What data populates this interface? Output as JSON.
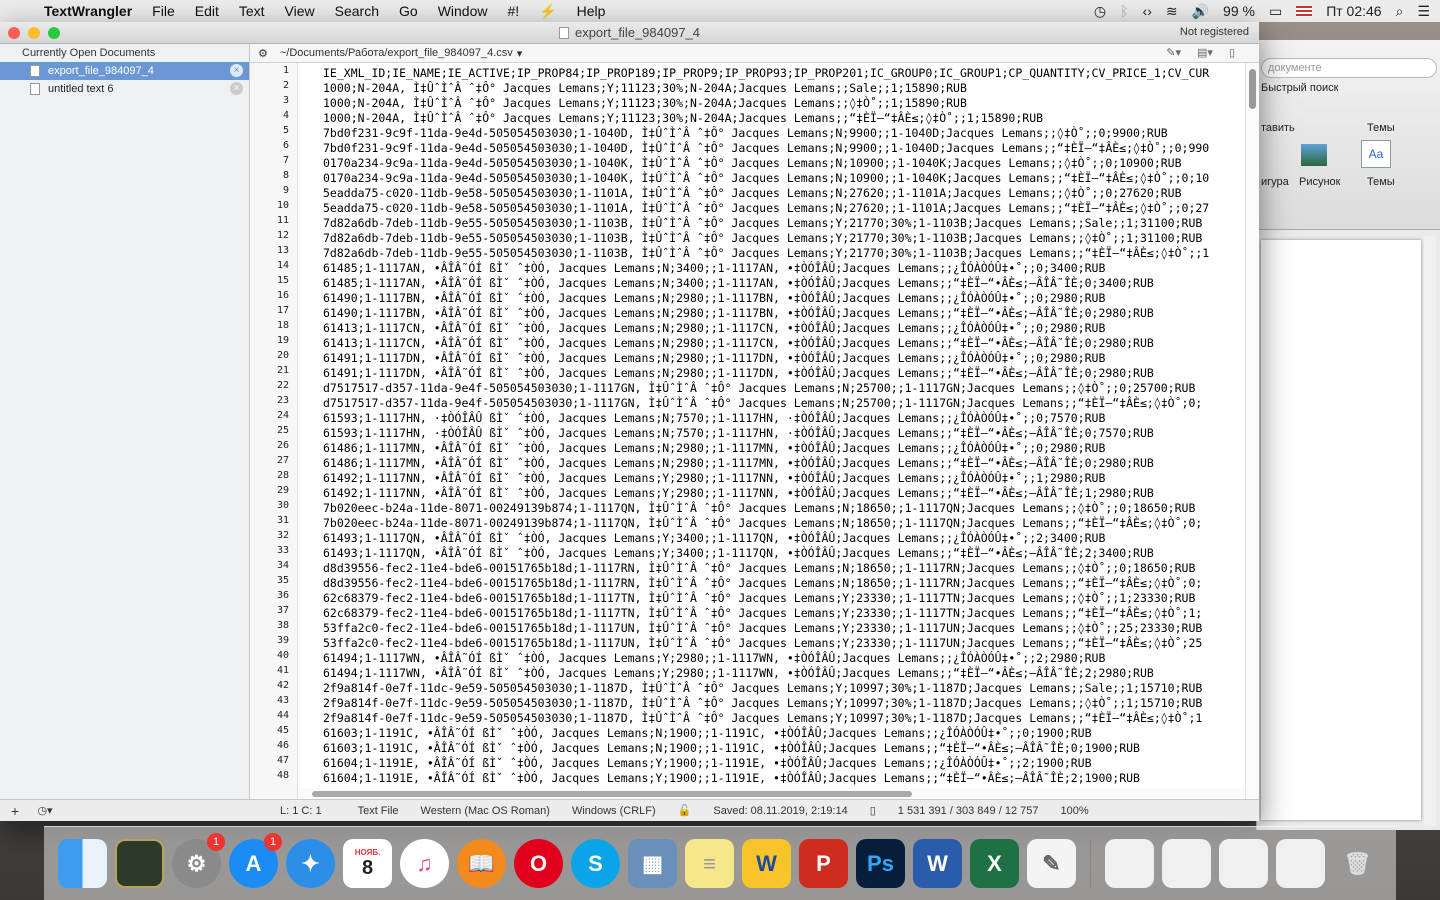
{
  "menubar": {
    "app": "TextWrangler",
    "items": [
      "File",
      "Edit",
      "Text",
      "View",
      "Search",
      "Go",
      "Window",
      "#!",
      "Help"
    ],
    "battery": "99 %",
    "clock": "Пт 02:46"
  },
  "window": {
    "title": "export_file_984097_4",
    "not_registered": "Not registered"
  },
  "sidebar": {
    "header": "Currently Open Documents",
    "docs": [
      "export_file_984097_4",
      "untitled text 6"
    ]
  },
  "navbar": {
    "path": "~/Documents/Работа/export_file_984097_4.csv"
  },
  "editor": {
    "line_numbers": [
      "1",
      "2",
      "3",
      "4",
      "5",
      "6",
      "7",
      "8",
      "9",
      "10",
      "11",
      "12",
      "13",
      "14",
      "15",
      "16",
      "17",
      "18",
      "19",
      "20",
      "21",
      "22",
      "23",
      "24",
      "25",
      "26",
      "27",
      "28",
      "29",
      "30",
      "31",
      "32",
      "33",
      "34",
      "35",
      "36",
      "37",
      "38",
      "39",
      "40",
      "41",
      "42",
      "43",
      "44",
      "45",
      "46",
      "47",
      "48"
    ],
    "lines": [
      "IE_XML_ID;IE_NAME;IE_ACTIVE;IP_PROP84;IP_PROP189;IP_PROP9;IP_PROP93;IP_PROP201;IC_GROUP0;IC_GROUP1;CP_QUANTITY;CV_PRICE_1;CV_CUR",
      "1000;N-204A, Ì‡ÛˆÌˆÂ ˆ‡Ô° Jacques Lemans;Y;11123;30%;N-204A;Jacques Lemans;;Sale;;1;15890;RUB",
      "1000;N-204A, Ì‡ÛˆÌˆÂ ˆ‡Ô° Jacques Lemans;Y;11123;30%;N-204A;Jacques Lemans;;◊‡Ò˚;;1;15890;RUB",
      "1000;N-204A, Ì‡ÛˆÌˆÂ ˆ‡Ô° Jacques Lemans;Y;11123;30%;N-204A;Jacques Lemans;;“‡ÈÏ–“‡ÂÈ≤;◊‡Ò˚;;1;15890;RUB",
      "7bd0f231-9c9f-11da-9e4d-505054503030;1-1040D, Ì‡ÛˆÌˆÂ ˆ‡Ô° Jacques Lemans;N;9900;;1-1040D;Jacques Lemans;;◊‡Ò˚;;0;9900;RUB",
      "7bd0f231-9c9f-11da-9e4d-505054503030;1-1040D, Ì‡ÛˆÌˆÂ ˆ‡Ô° Jacques Lemans;N;9900;;1-1040D;Jacques Lemans;;“‡ÈÏ–“‡ÂÈ≤;◊‡Ò˚;;0;990",
      "0170a234-9c9a-11da-9e4d-505054503030;1-1040K, Ì‡ÛˆÌˆÂ ˆ‡Ô° Jacques Lemans;N;10900;;1-1040K;Jacques Lemans;;◊‡Ò˚;;0;10900;RUB",
      "0170a234-9c9a-11da-9e4d-505054503030;1-1040K, Ì‡ÛˆÌˆÂ ˆ‡Ô° Jacques Lemans;N;10900;;1-1040K;Jacques Lemans;;“‡ÈÏ–“‡ÂÈ≤;◊‡Ò˚;;0;10",
      "5eadda75-c020-11db-9e58-505054503030;1-1101A, Ì‡ÛˆÌˆÂ ˆ‡Ô° Jacques Lemans;N;27620;;1-1101A;Jacques Lemans;;◊‡Ò˚;;0;27620;RUB",
      "5eadda75-c020-11db-9e58-505054503030;1-1101A, Ì‡ÛˆÌˆÂ ˆ‡Ô° Jacques Lemans;N;27620;;1-1101A;Jacques Lemans;;“‡ÈÏ–“‡ÂÈ≤;◊‡Ò˚;;0;27",
      "7d82a6db-7deb-11db-9e55-505054503030;1-1103B, Ì‡ÛˆÌˆÂ ˆ‡Ô° Jacques Lemans;Y;21770;30%;1-1103B;Jacques Lemans;;Sale;;1;31100;RUB",
      "7d82a6db-7deb-11db-9e55-505054503030;1-1103B, Ì‡ÛˆÌˆÂ ˆ‡Ô° Jacques Lemans;Y;21770;30%;1-1103B;Jacques Lemans;;◊‡Ò˚;;1;31100;RUB",
      "7d82a6db-7deb-11db-9e55-505054503030;1-1103B, Ì‡ÛˆÌˆÂ ˆ‡Ô° Jacques Lemans;Y;21770;30%;1-1103B;Jacques Lemans;;“‡ÈÏ–“‡ÂÈ≤;◊‡Ò˚;;1",
      "61485;1-1117AN, •ÂÎÂ˜ÓÍ ßÌˇ ˆ‡ÒÓ, Jacques Lemans;N;3400;;1-1117AN, •‡ÒÓÎÂÛ;Jacques Lemans;;¿ÎÓÀÒÓÛ‡•˚;;0;3400;RUB",
      "61485;1-1117AN, •ÂÎÂ˜ÓÍ ßÌˇ ˆ‡ÒÓ, Jacques Lemans;N;3400;;1-1117AN, •‡ÒÓÎÂÛ;Jacques Lemans;;“‡ÈÏ–“•ÂÈ≤;–ÂÎÂ˜ÎÈ;0;3400;RUB",
      "61490;1-1117BN, •ÂÎÂ˜ÓÍ ßÌˇ ˆ‡ÒÓ, Jacques Lemans;N;2980;;1-1117BN, •‡ÒÓÎÂÛ;Jacques Lemans;;¿ÎÓÀÒÓÛ‡•˚;;0;2980;RUB",
      "61490;1-1117BN, •ÂÎÂ˜ÓÍ ßÌˇ ˆ‡ÒÓ, Jacques Lemans;N;2980;;1-1117BN, •‡ÒÓÎÂÛ;Jacques Lemans;;“‡ÈÏ–“•ÂÈ≤;–ÂÎÂ˜ÎÈ;0;2980;RUB",
      "61413;1-1117CN, •ÂÎÂ˜ÓÍ ßÌˇ ˆ‡ÒÓ, Jacques Lemans;N;2980;;1-1117CN, •‡ÒÓÎÂÛ;Jacques Lemans;;¿ÎÓÀÒÓÛ‡•˚;;0;2980;RUB",
      "61413;1-1117CN, •ÂÎÂ˜ÓÍ ßÌˇ ˆ‡ÒÓ, Jacques Lemans;N;2980;;1-1117CN, •‡ÒÓÎÂÛ;Jacques Lemans;;“‡ÈÏ–“•ÂÈ≤;–ÂÎÂ˜ÎÈ;0;2980;RUB",
      "61491;1-1117DN, •ÂÎÂ˜ÓÍ ßÌˇ ˆ‡ÒÓ, Jacques Lemans;N;2980;;1-1117DN, •‡ÒÓÎÂÛ;Jacques Lemans;;¿ÎÓÀÒÓÛ‡•˚;;0;2980;RUB",
      "61491;1-1117DN, •ÂÎÂ˜ÓÍ ßÌˇ ˆ‡ÒÓ, Jacques Lemans;N;2980;;1-1117DN, •‡ÒÓÎÂÛ;Jacques Lemans;;“‡ÈÏ–“•ÂÈ≤;–ÂÎÂ˜ÎÈ;0;2980;RUB",
      "d7517517-d357-11da-9e4f-505054503030;1-1117GN, Ì‡ÛˆÌˆÂ ˆ‡Ô° Jacques Lemans;N;25700;;1-1117GN;Jacques Lemans;;◊‡Ò˚;;0;25700;RUB",
      "d7517517-d357-11da-9e4f-505054503030;1-1117GN, Ì‡ÛˆÌˆÂ ˆ‡Ô° Jacques Lemans;N;25700;;1-1117GN;Jacques Lemans;;“‡ÈÏ–“‡ÂÈ≤;◊‡Ò˚;0;",
      "61593;1-1117HN, ·‡ÒÓÎÂÛ ßÌˇ ˆ‡ÒÓ, Jacques Lemans;N;7570;;1-1117HN, ·‡ÒÓÎÂÛ;Jacques Lemans;;¿ÎÓÀÒÓÛ‡•˚;;0;7570;RUB",
      "61593;1-1117HN, ·‡ÒÓÎÂÛ ßÌˇ ˆ‡ÒÓ, Jacques Lemans;N;7570;;1-1117HN, ·‡ÒÓÎÂÛ;Jacques Lemans;;“‡ÈÏ–“•ÂÈ≤;–ÂÎÂ˜ÎÈ;0;7570;RUB",
      "61486;1-1117MN, •ÂÎÂ˜ÓÍ ßÌˇ ˆ‡ÒÓ, Jacques Lemans;N;2980;;1-1117MN, •‡ÒÓÎÂÛ;Jacques Lemans;;¿ÎÓÀÒÓÛ‡•˚;;0;2980;RUB",
      "61486;1-1117MN, •ÂÎÂ˜ÓÍ ßÌˇ ˆ‡ÒÓ, Jacques Lemans;N;2980;;1-1117MN, •‡ÒÓÎÂÛ;Jacques Lemans;;“‡ÈÏ–“•ÂÈ≤;–ÂÎÂ˜ÎÈ;0;2980;RUB",
      "61492;1-1117NN, •ÂÎÂ˜ÓÍ ßÌˇ ˆ‡ÒÓ, Jacques Lemans;Y;2980;;1-1117NN, •‡ÒÓÎÂÛ;Jacques Lemans;;¿ÎÓÀÒÓÛ‡•˚;;1;2980;RUB",
      "61492;1-1117NN, •ÂÎÂ˜ÓÍ ßÌˇ ˆ‡ÒÓ, Jacques Lemans;Y;2980;;1-1117NN, •‡ÒÓÎÂÛ;Jacques Lemans;;“‡ÈÏ–“•ÂÈ≤;–ÂÎÂ˜ÎÈ;1;2980;RUB",
      "7b020eec-b24a-11de-8071-00249139b874;1-1117QN, Ì‡ÛˆÌˆÂ ˆ‡Ô° Jacques Lemans;N;18650;;1-1117QN;Jacques Lemans;;◊‡Ò˚;;0;18650;RUB",
      "7b020eec-b24a-11de-8071-00249139b874;1-1117QN, Ì‡ÛˆÌˆÂ ˆ‡Ô° Jacques Lemans;N;18650;;1-1117QN;Jacques Lemans;;“‡ÈÏ–“‡ÂÈ≤;◊‡Ò˚;0;",
      "61493;1-1117QN, •ÂÎÂ˜ÓÍ ßÌˇ ˆ‡ÒÓ, Jacques Lemans;Y;3400;;1-1117QN, •‡ÒÓÎÂÛ;Jacques Lemans;;¿ÎÓÀÒÓÛ‡•˚;;2;3400;RUB",
      "61493;1-1117QN, •ÂÎÂ˜ÓÍ ßÌˇ ˆ‡ÒÓ, Jacques Lemans;Y;3400;;1-1117QN, •‡ÒÓÎÂÛ;Jacques Lemans;;“‡ÈÏ–“•ÂÈ≤;–ÂÎÂ˜ÎÈ;2;3400;RUB",
      "d8d39556-fec2-11e4-bde6-00151765b18d;1-1117RN, Ì‡ÛˆÌˆÂ ˆ‡Ô° Jacques Lemans;N;18650;;1-1117RN;Jacques Lemans;;◊‡Ò˚;;0;18650;RUB",
      "d8d39556-fec2-11e4-bde6-00151765b18d;1-1117RN, Ì‡ÛˆÌˆÂ ˆ‡Ô° Jacques Lemans;N;18650;;1-1117RN;Jacques Lemans;;“‡ÈÏ–“‡ÂÈ≤;◊‡Ò˚;0;",
      "62c68379-fec2-11e4-bde6-00151765b18d;1-1117TN, Ì‡ÛˆÌˆÂ ˆ‡Ô° Jacques Lemans;Y;23330;;1-1117TN;Jacques Lemans;;◊‡Ò˚;;1;23330;RUB",
      "62c68379-fec2-11e4-bde6-00151765b18d;1-1117TN, Ì‡ÛˆÌˆÂ ˆ‡Ô° Jacques Lemans;Y;23330;;1-1117TN;Jacques Lemans;;“‡ÈÏ–“‡ÂÈ≤;◊‡Ò˚;1;",
      "53ffa2c0-fec2-11e4-bde6-00151765b18d;1-1117UN, Ì‡ÛˆÌˆÂ ˆ‡Ô° Jacques Lemans;Y;23330;;1-1117UN;Jacques Lemans;;◊‡Ò˚;;25;23330;RUB",
      "53ffa2c0-fec2-11e4-bde6-00151765b18d;1-1117UN, Ì‡ÛˆÌˆÂ ˆ‡Ô° Jacques Lemans;Y;23330;;1-1117UN;Jacques Lemans;;“‡ÈÏ–“‡ÂÈ≤;◊‡Ò˚;25",
      "61494;1-1117WN, •ÂÎÂ˜ÓÍ ßÌˇ ˆ‡ÒÓ, Jacques Lemans;Y;2980;;1-1117WN, •‡ÒÓÎÂÛ;Jacques Lemans;;¿ÎÓÀÒÓÛ‡•˚;;2;2980;RUB",
      "61494;1-1117WN, •ÂÎÂ˜ÓÍ ßÌˇ ˆ‡ÒÓ, Jacques Lemans;Y;2980;;1-1117WN, •‡ÒÓÎÂÛ;Jacques Lemans;;“‡ÈÏ–“•ÂÈ≤;–ÂÎÂ˜ÎÈ;2;2980;RUB",
      "2f9a814f-0e7f-11dc-9e59-505054503030;1-1187D, Ì‡ÛˆÌˆÂ ˆ‡Ô° Jacques Lemans;Y;10997;30%;1-1187D;Jacques Lemans;;Sale;;1;15710;RUB",
      "2f9a814f-0e7f-11dc-9e59-505054503030;1-1187D, Ì‡ÛˆÌˆÂ ˆ‡Ô° Jacques Lemans;Y;10997;30%;1-1187D;Jacques Lemans;;◊‡Ò˚;;1;15710;RUB",
      "2f9a814f-0e7f-11dc-9e59-505054503030;1-1187D, Ì‡ÛˆÌˆÂ ˆ‡Ô° Jacques Lemans;Y;10997;30%;1-1187D;Jacques Lemans;;“‡ÈÏ–“‡ÂÈ≤;◊‡Ò˚;1",
      "61603;1-1191C, •ÂÎÂ˜ÓÍ ßÌˇ ˆ‡ÒÓ, Jacques Lemans;N;1900;;1-1191C, •‡ÒÓÎÂÛ;Jacques Lemans;;¿ÎÓÀÒÓÛ‡•˚;;0;1900;RUB",
      "61603;1-1191C, •ÂÎÂ˜ÓÍ ßÌˇ ˆ‡ÒÓ, Jacques Lemans;N;1900;;1-1191C, •‡ÒÓÎÂÛ;Jacques Lemans;;“‡ÈÏ–“•ÂÈ≤;–ÂÎÂ˜ÎÈ;0;1900;RUB",
      "61604;1-1191E, •ÂÎÂ˜ÓÍ ßÌˇ ˆ‡ÒÓ, Jacques Lemans;Y;1900;;1-1191E, •‡ÒÓÎÂÛ;Jacques Lemans;;¿ÎÓÀÒÓÛ‡•˚;;2;1900;RUB",
      "61604;1-1191E, •ÂÎÂ˜ÓÍ ßÌˇ ˆ‡ÒÓ, Jacques Lemans;Y;1900;;1-1191E, •‡ÒÓÎÂÛ;Jacques Lemans;;“‡ÈÏ–“•ÂÈ≤;–ÂÎÂ˜ÎÈ;2;1900;RUB"
    ]
  },
  "status": {
    "position": "L: 1 C: 1",
    "syntax": "Text File",
    "encoding": "Western (Mac OS Roman)",
    "line_endings": "Windows (CRLF)",
    "saved": "Saved: 08.11.2019, 2:19:14",
    "counts": "1 531 391 / 303 849 / 12 757",
    "zoom": "100%"
  },
  "word": {
    "search_placeholder": "документе",
    "quick_search": "Быстрый поиск",
    "insert": "тавить",
    "themes_hdr": "Темы",
    "shape": "игура",
    "picture": "Рисунок",
    "themes": "Темы"
  },
  "dock": {
    "calendar_month": "НОЯБ.",
    "calendar_day": "8",
    "badge_prefs": "1",
    "badge_appstore": "1"
  }
}
